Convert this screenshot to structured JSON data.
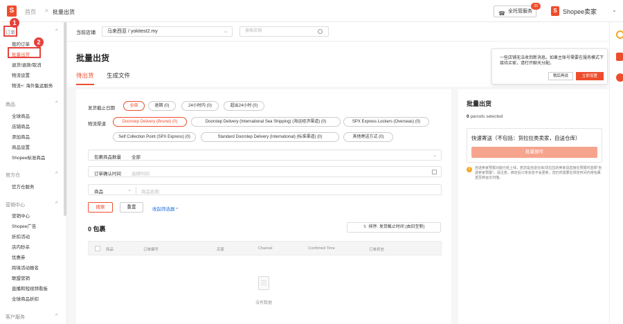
{
  "topbar": {
    "logo": "S",
    "breadcrumb_home": "首页",
    "breadcrumb_sep": ">",
    "breadcrumb_current": "批量出货",
    "service_label": "全托管服务",
    "service_badge": "33",
    "shop_logo": "S",
    "shop_name": "Shopee卖家",
    "icons": [
      "headset-icon",
      "chevron-down-icon"
    ]
  },
  "sidebar": {
    "groups": [
      {
        "label": "订单",
        "items": [
          "我的订单",
          "批量出货",
          "退货/退款/取消",
          "物流设置",
          "物流+: 海外集运服务"
        ]
      },
      {
        "label": "商品",
        "items": [
          "全球商品",
          "店铺商品",
          "添加商品",
          "商品设置",
          "Shopee标准商品"
        ]
      },
      {
        "label": "官方仓",
        "items": [
          "官方仓服务"
        ]
      },
      {
        "label": "营销中心",
        "items": [
          "营销中心",
          "Shopee广告",
          "折扣活动",
          "店内秒杀",
          "优惠券",
          "跨境活动报名",
          "联盟营销",
          "直播和短视频看板",
          "全球商品折扣"
        ]
      },
      {
        "label": "客户服务",
        "items": []
      }
    ],
    "step1": "1",
    "step2": "2",
    "highlight_color": "#e5423d"
  },
  "shopbar": {
    "label": "当前店铺",
    "selected_shop": "马来西亚 / yokitest2.my",
    "search_placeholder": "搜索店铺"
  },
  "header": {
    "title": "批量出货",
    "tabs": [
      "待出货",
      "生成文件"
    ]
  },
  "notice": {
    "text": "一些店铺无法收到新消息。如果主账号需要在服务模式下接待买家，请打开聊天分配。",
    "later_label": "稍后再说",
    "setup_label": "立即设置"
  },
  "filters": {
    "deadline_label": "发货截止日期",
    "deadline_options": [
      "全部",
      "逾期 (0)",
      "24小时内 (0)",
      "超出24小时 (0)"
    ],
    "channel_label": "物流渠道",
    "channel_options": [
      "Doorstep Delivery (Brunei) (0)",
      "Doorstep Delivery (International Sea Shipping) (海运经济渠道) (0)",
      "SPX Express Lockers (Overseas) (0)",
      "Self Collection Point (SPX Express) (0)",
      "Standard Doorstep Delivery (International) (标准渠道) (0)",
      "其他寄送方式 (0)"
    ],
    "qty_prefix": "包裹商品数量",
    "qty_value": "全部",
    "confirm_prefix": "订单确认时间",
    "confirm_placeholder": "选择时间",
    "product_prefix": "商品",
    "product_placeholder": "商品名称",
    "search_label": "搜索",
    "reset_label": "重置",
    "collapse_label": "收起筛选器 ^"
  },
  "results": {
    "count_title": "0 包裹",
    "sort_label": "排序: 发货截止时间 (由旧至新)",
    "columns": [
      "商品",
      "订单编号",
      "买家",
      "Channel",
      "Confirmed Time",
      "订单状态"
    ],
    "empty_text": "没有数据"
  },
  "right_panel": {
    "title": "批量出货",
    "parcels_count": "0",
    "parcels_label": "parcels selected",
    "box_title": "快速寄送（不包括：货拉拉类卖家，自送仓库）",
    "box_button": "批量操作",
    "warning": "自送卖家预报功能已经上线，若您是自送仓库/货拉拉的卖家请直接在预报时选择\"自送卖家预报\"。请注意，绑定后订单状态不会更新，您仍然需要在规定时间内将包裹送至转运仓扫描。"
  },
  "colors": {
    "accent": "#ee4d2d",
    "link": "#2673dd",
    "disabled_button": "#f6a48e"
  }
}
